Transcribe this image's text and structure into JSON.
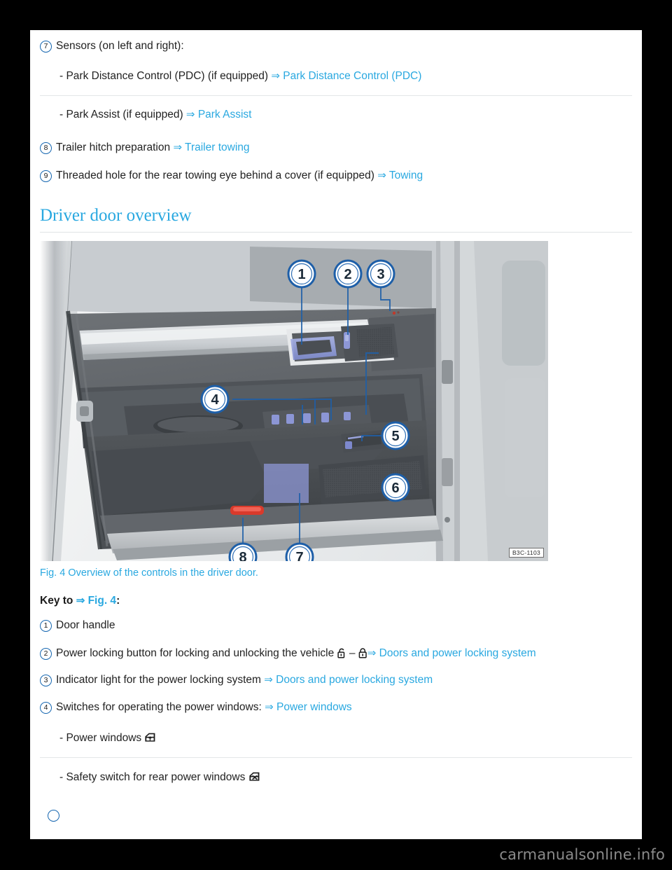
{
  "page": {
    "watermark": "carmanualsonline.info"
  },
  "top_items": [
    {
      "number": "7",
      "text": "Sensors (on left and right):",
      "sub": [
        {
          "text": "- Park Distance Control (PDC) (if equipped)",
          "arrow": "⇒",
          "link": "Park Distance Control (PDC)"
        },
        {
          "text": "- Park Assist (if equipped)",
          "arrow": "⇒",
          "link": "Park Assist"
        }
      ]
    },
    {
      "number": "8",
      "text": "Trailer hitch preparation",
      "arrow": "⇒",
      "link": "Trailer towing"
    },
    {
      "number": "9",
      "text": "Threaded hole for the rear towing eye behind a cover (if equipped)",
      "arrow": "⇒",
      "link": "Towing"
    }
  ],
  "section": {
    "heading": "Driver door overview"
  },
  "figure": {
    "code": "B3C-1103",
    "caption": "Fig. 4 Overview of the controls in the driver door.",
    "callouts": [
      "1",
      "2",
      "3",
      "4",
      "5",
      "6",
      "7",
      "8"
    ]
  },
  "key": {
    "label_prefix": "Key to",
    "arrow": "⇒",
    "label_link": "Fig. 4",
    "label_suffix": ":",
    "items": [
      {
        "number": "1",
        "text": "Door handle"
      },
      {
        "number": "2",
        "text_before": "Power locking button for locking and unlocking the vehicle",
        "icon_unlock": "padlock-open-icon",
        "separator": "–",
        "icon_lock": "padlock-closed-icon",
        "arrow": "⇒",
        "link": "Doors and power locking system"
      },
      {
        "number": "3",
        "text_before": "Indicator light for the power locking system",
        "arrow": "⇒",
        "link": "Doors and power locking system"
      },
      {
        "number": "4",
        "text_before": "Switches for operating the power windows:",
        "arrow": "⇒",
        "link": "Power windows",
        "sub": [
          {
            "text": "- Power windows",
            "icon": "power-window-icon"
          },
          {
            "text": "- Safety switch for rear power windows",
            "icon": "power-window-disabled-icon"
          }
        ]
      }
    ]
  },
  "colors": {
    "link": "#29a8e0",
    "circle_outline": "#1566b0",
    "text": "#222222",
    "rule": "#e3e6e8",
    "page_bg": "#ffffff",
    "frame_bg": "#000000",
    "watermark": "#8b8b8b"
  }
}
